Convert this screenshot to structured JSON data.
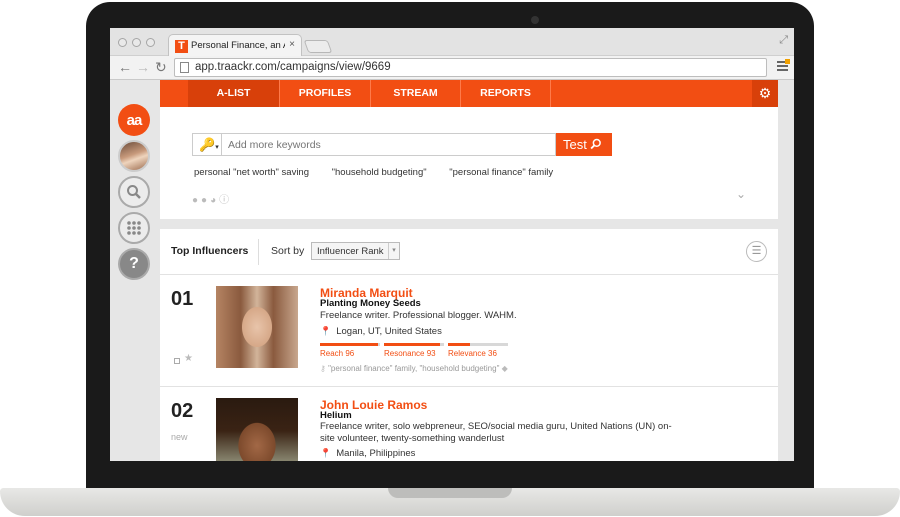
{
  "browser": {
    "tab_title": "Personal Finance, an A-List",
    "tab_favicon": "T",
    "tab_close": "×",
    "url": "app.traackr.com/campaigns/view/9669"
  },
  "rail": {
    "logo_text": "aa"
  },
  "nav": {
    "tabs": [
      {
        "label": "A-LIST",
        "active": true
      },
      {
        "label": "PROFILES",
        "active": false
      },
      {
        "label": "STREAM",
        "active": false
      },
      {
        "label": "REPORTS",
        "active": false
      }
    ]
  },
  "keywords": {
    "placeholder": "Add more keywords",
    "test_label": "Test",
    "items": [
      "personal \"net worth\" saving",
      "\"household budgeting\"",
      "\"personal finance\" family"
    ]
  },
  "results": {
    "title": "Top Influencers",
    "sort_label": "Sort by",
    "sort_value": "Influencer Rank",
    "influencers": [
      {
        "rank": "01",
        "rank_note": "",
        "name": "Miranda Marquit",
        "blog": "Planting Money Seeds",
        "bio": "Freelance writer. Professional blogger. WAHM.",
        "location": "Logan, UT, United States",
        "reach_label": "Reach 96",
        "reach": 96,
        "resonance_label": "Resonance 93",
        "resonance": 93,
        "relevance_label": "Relevance 36",
        "relevance": 36,
        "matched": "\"personal finance\" family, \"household budgeting\""
      },
      {
        "rank": "02",
        "rank_note": "new",
        "name": "John Louie Ramos",
        "blog": "Helium",
        "bio": "Freelance writer, solo webpreneur, SEO/social media guru, United Nations (UN) on-site volunteer, twenty-something wanderlust",
        "location": "Manila, Philippines"
      }
    ]
  },
  "colors": {
    "brand": "#f24e13",
    "brand_dark": "#d8400a"
  }
}
